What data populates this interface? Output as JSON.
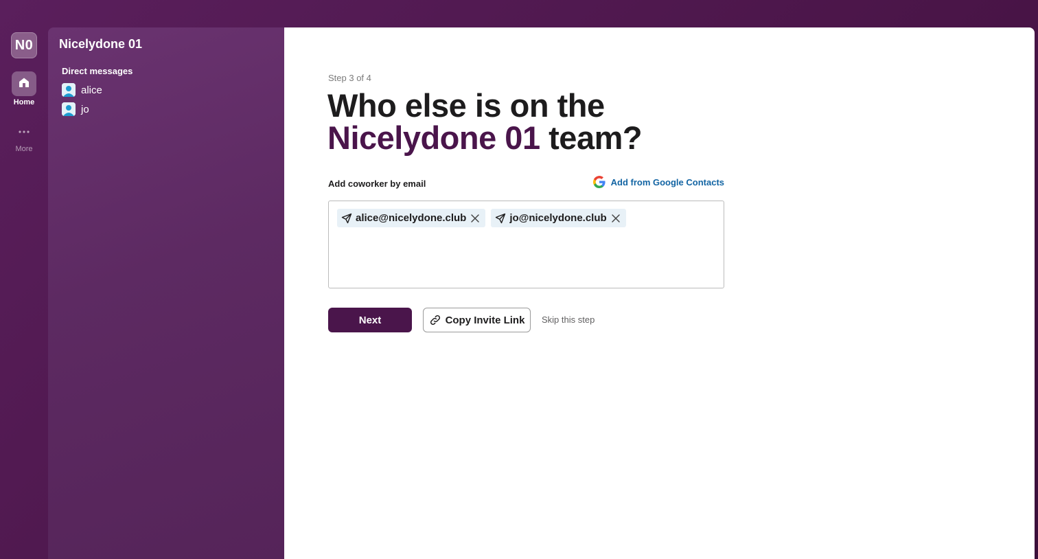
{
  "rail": {
    "workspace_initials": "N0",
    "home_label": "Home",
    "more_label": "More"
  },
  "sidebar": {
    "workspace_name": "Nicelydone 01",
    "section_title": "Direct messages",
    "items": [
      {
        "label": "alice"
      },
      {
        "label": "jo"
      }
    ]
  },
  "main": {
    "step": "Step 3 of 4",
    "headline_line1": "Who else is on the",
    "headline_accent": "Nicelydone 01",
    "headline_rest": " team?",
    "field_label": "Add coworker by email",
    "google_link": "Add from Google Contacts",
    "emails": [
      {
        "value": "alice@nicelydone.club"
      },
      {
        "value": "jo@nicelydone.club"
      }
    ],
    "next_label": "Next",
    "copy_label": "Copy Invite Link",
    "skip_label": "Skip this step"
  },
  "colors": {
    "aubergine": "#4a154b",
    "link_blue": "#1264a3",
    "chip_bg": "#e8f1f7"
  },
  "icons": [
    "home-icon",
    "more-icon",
    "user-avatar-icon",
    "google-icon",
    "send-icon",
    "close-icon",
    "link-icon"
  ]
}
